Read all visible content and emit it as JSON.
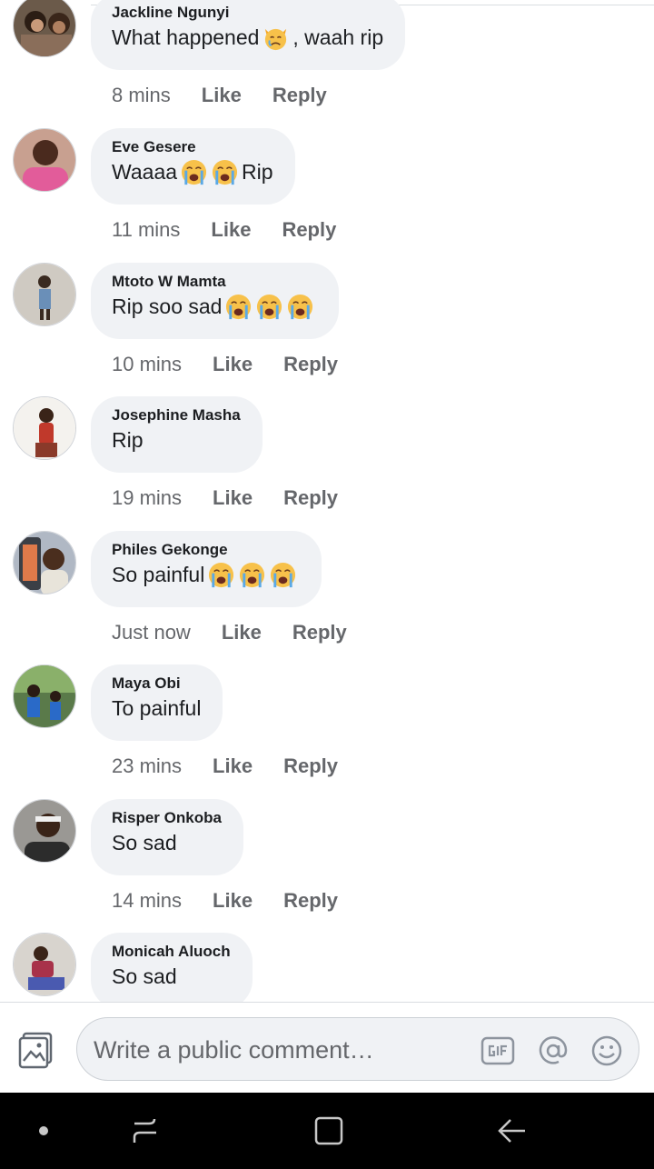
{
  "comment_actions": {
    "like_label": "Like",
    "reply_label": "Reply"
  },
  "comments": [
    {
      "author": "Jackline Ngunyi",
      "text_before": "What happened ",
      "text_after": ", waah rip",
      "emojis": [
        "crying-cat-emoji"
      ],
      "time": "8 mins"
    },
    {
      "author": "Eve Gesere",
      "text_before": "Waaaa ",
      "text_after": " Rip",
      "emojis": [
        "loudly-crying-emoji",
        "loudly-crying-emoji"
      ],
      "time": "11 mins"
    },
    {
      "author": "Mtoto W Mamta",
      "text_before": "Rip soo sad ",
      "text_after": "",
      "emojis": [
        "loudly-crying-emoji",
        "loudly-crying-emoji",
        "loudly-crying-emoji"
      ],
      "time": "10 mins"
    },
    {
      "author": "Josephine Masha",
      "text_before": "Rip",
      "text_after": "",
      "emojis": [],
      "time": "19 mins"
    },
    {
      "author": "Philes Gekonge",
      "text_before": "So painful ",
      "text_after": "",
      "emojis": [
        "loudly-crying-emoji",
        "loudly-crying-emoji",
        "loudly-crying-emoji"
      ],
      "time": "Just now"
    },
    {
      "author": "Maya Obi",
      "text_before": "To painful",
      "text_after": "",
      "emojis": [],
      "time": "23 mins"
    },
    {
      "author": "Risper Onkoba",
      "text_before": "So sad",
      "text_after": "",
      "emojis": [],
      "time": "14 mins"
    },
    {
      "author": "Monicah Aluoch",
      "text_before": "So sad",
      "text_after": "",
      "emojis": [],
      "time": ""
    }
  ],
  "composer": {
    "placeholder": "Write a public comment…",
    "icons": [
      "photo-icon",
      "gif-icon",
      "mention-icon",
      "emoji-icon"
    ]
  },
  "navbar": {
    "icons": [
      "nav-dot-icon",
      "recents-icon",
      "home-icon",
      "back-icon"
    ]
  },
  "colors": {
    "bubble": "#f0f2f5",
    "meta_text": "#65676b",
    "navbar": "#000000"
  }
}
